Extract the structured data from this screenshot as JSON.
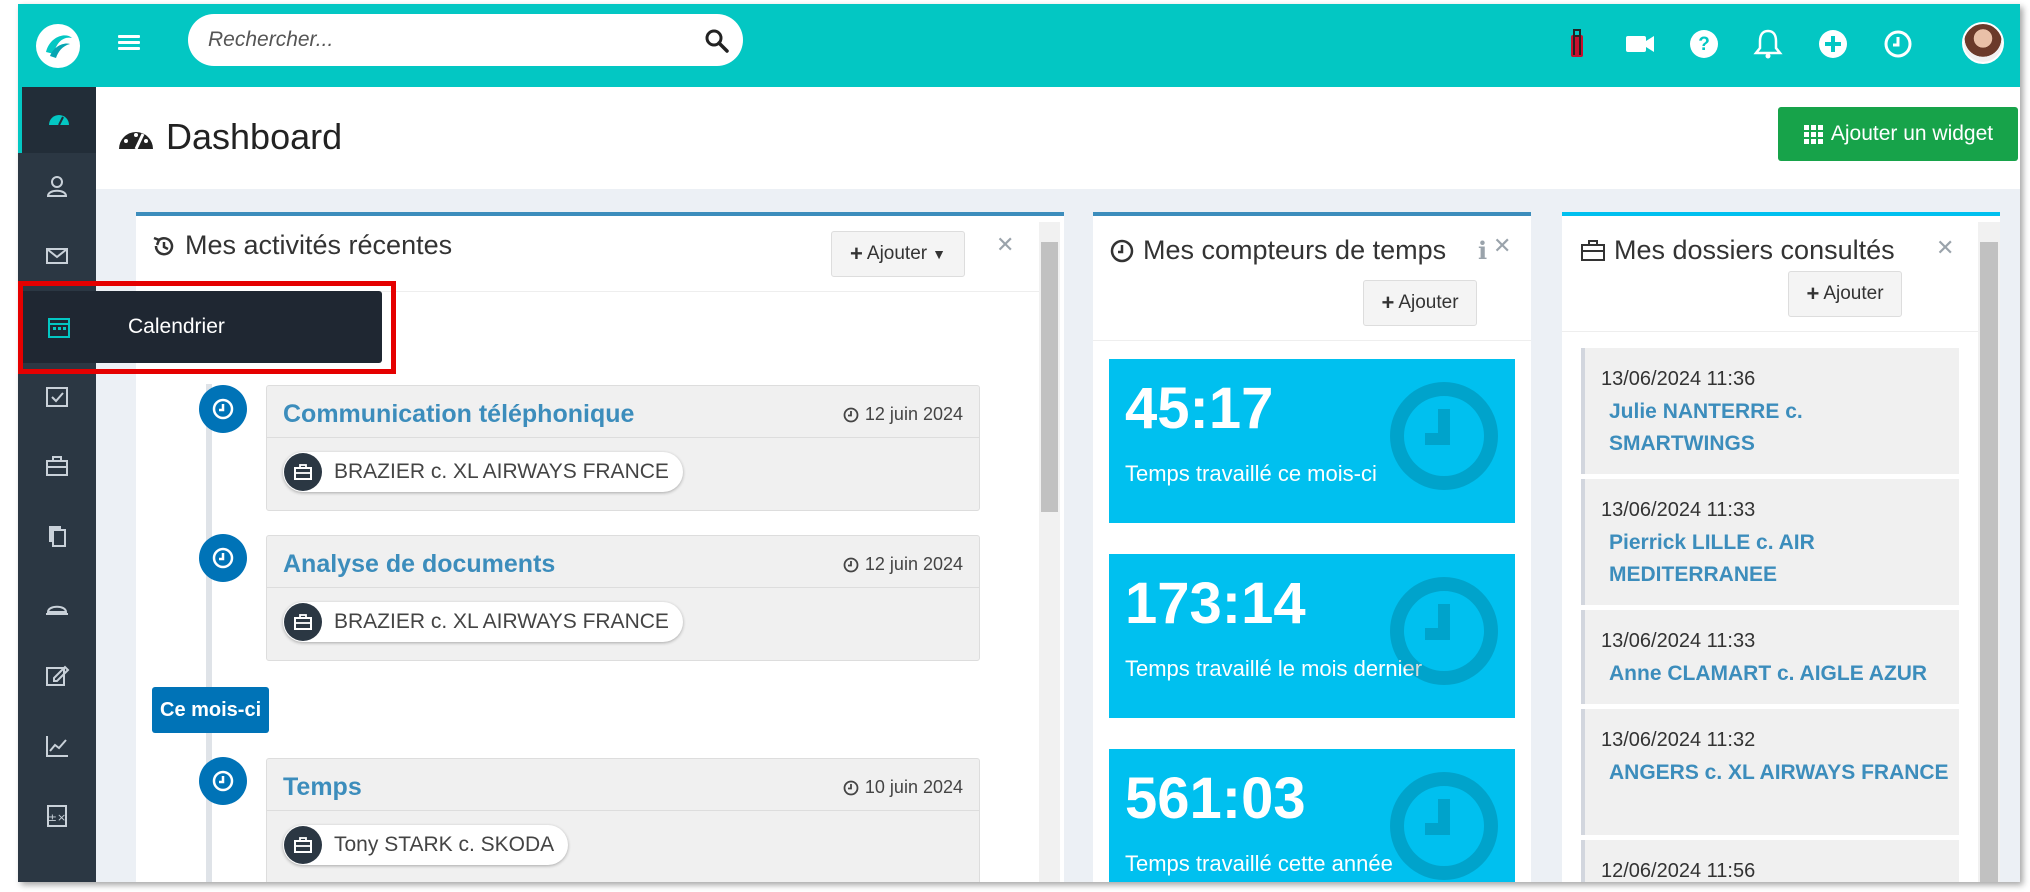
{
  "topbar": {
    "search_placeholder": "Rechercher..."
  },
  "sidebar": {
    "items": [
      "dashboard-icon",
      "contacts-icon",
      "mail-icon",
      "calendar-icon",
      "tasks-icon",
      "briefcase-icon",
      "documents-icon",
      "bell-counter-icon",
      "edit-icon",
      "chart-icon",
      "calculator-icon"
    ],
    "tooltip": "Calendrier"
  },
  "page": {
    "title": "Dashboard",
    "add_widget": "Ajouter un widget"
  },
  "activities": {
    "title": "Mes activités récentes",
    "add_label": "Ajouter",
    "month_label": "Ce mois-ci",
    "items": [
      {
        "title": "Communication téléphonique",
        "date": "12 juin 2024",
        "tag": "BRAZIER c. XL AIRWAYS FRANCE"
      },
      {
        "title": "Analyse de documents",
        "date": "12 juin 2024",
        "tag": "BRAZIER c. XL AIRWAYS FRANCE"
      },
      {
        "title": "Temps",
        "date": "10 juin 2024",
        "tag": "Tony STARK c. SKODA"
      }
    ]
  },
  "counters": {
    "title": "Mes compteurs de temps",
    "add_label": "Ajouter",
    "items": [
      {
        "value": "45:17",
        "label": "Temps travaillé ce mois-ci"
      },
      {
        "value": "173:14",
        "label": "Temps travaillé le mois dernier"
      },
      {
        "value": "561:03",
        "label": "Temps travaillé cette année"
      }
    ]
  },
  "dossiers": {
    "title": "Mes dossiers consultés",
    "add_label": "Ajouter",
    "items": [
      {
        "date": "13/06/2024 11:36",
        "name": "Julie NANTERRE c. SMARTWINGS"
      },
      {
        "date": "13/06/2024 11:33",
        "name": "Pierrick LILLE c. AIR MEDITERRANEE"
      },
      {
        "date": "13/06/2024 11:33",
        "name": "Anne CLAMART c. AIGLE AZUR"
      },
      {
        "date": "13/06/2024 11:32",
        "name": "ANGERS c. XL AIRWAYS FRANCE"
      },
      {
        "date": "12/06/2024 11:56",
        "name": ""
      }
    ]
  },
  "colors": {
    "topbar": "#03c7c3",
    "sidebar": "#2b3743",
    "counter": "#00c0ef",
    "link": "#3c8dbc",
    "success": "#17a34a",
    "highlight": "#e50000"
  }
}
